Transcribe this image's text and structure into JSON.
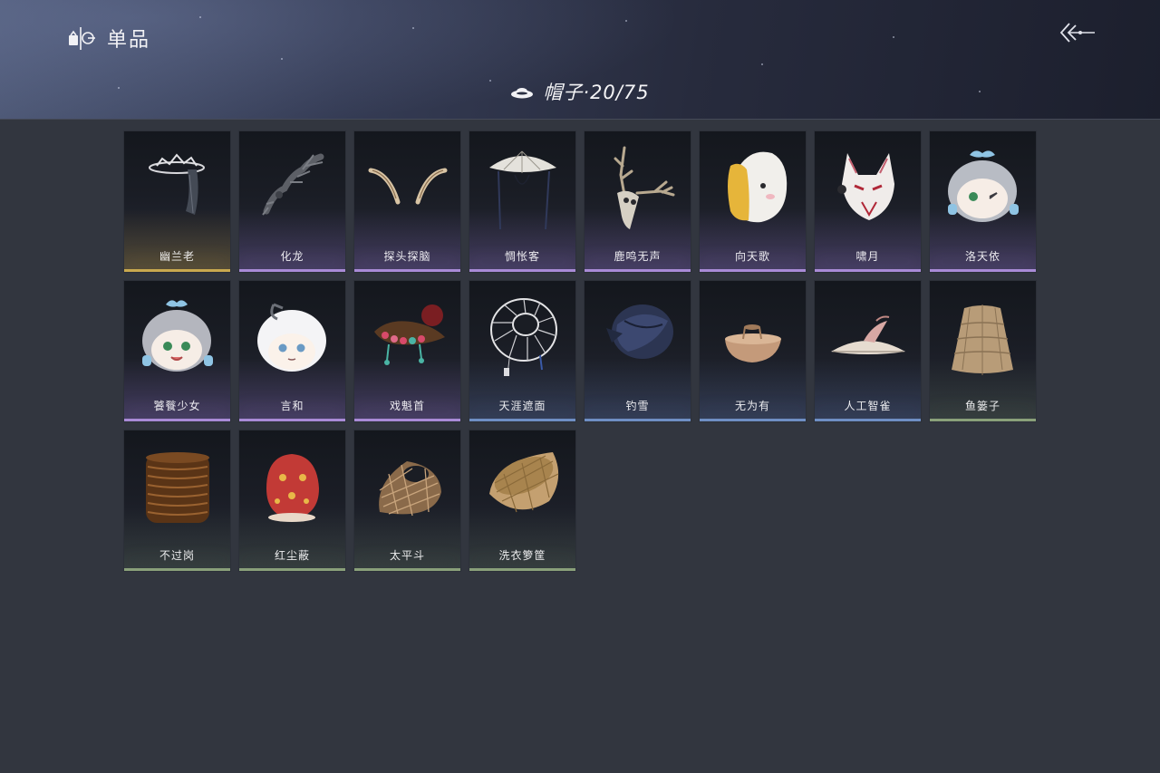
{
  "header": {
    "title": "单品",
    "brand_icon": "hat-wardrobe-icon",
    "back_icon": "back-arrow-icon"
  },
  "category": {
    "icon": "hat-icon",
    "label": "帽子·20/75"
  },
  "rarity_colors": {
    "gold": "#c9a94f",
    "purple": "#a98bd6",
    "blue": "#6f8fc4",
    "green": "#8aa07a"
  },
  "items": [
    {
      "name": "幽兰老",
      "rarity": "gold"
    },
    {
      "name": "化龙",
      "rarity": "purple"
    },
    {
      "name": "探头探脑",
      "rarity": "purple"
    },
    {
      "name": "惆怅客",
      "rarity": "purple"
    },
    {
      "name": "鹿鸣无声",
      "rarity": "purple"
    },
    {
      "name": "向天歌",
      "rarity": "purple"
    },
    {
      "name": "啸月",
      "rarity": "purple"
    },
    {
      "name": "洛天依",
      "rarity": "purple"
    },
    {
      "name": "饕餮少女",
      "rarity": "purple"
    },
    {
      "name": "言和",
      "rarity": "purple"
    },
    {
      "name": "戏魁首",
      "rarity": "purple"
    },
    {
      "name": "天涯遮面",
      "rarity": "blue"
    },
    {
      "name": "钓雪",
      "rarity": "blue"
    },
    {
      "name": "无为有",
      "rarity": "blue"
    },
    {
      "name": "人工智雀",
      "rarity": "blue"
    },
    {
      "name": "鱼篓子",
      "rarity": "green"
    },
    {
      "name": "不过岗",
      "rarity": "green"
    },
    {
      "name": "红尘蔽",
      "rarity": "green"
    },
    {
      "name": "太平斗",
      "rarity": "green"
    },
    {
      "name": "洗衣箩筐",
      "rarity": "green"
    }
  ]
}
